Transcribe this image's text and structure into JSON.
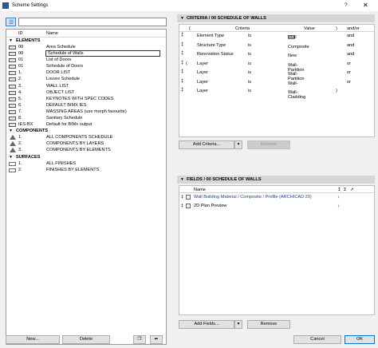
{
  "window": {
    "title": "Scheme Settings",
    "help": "?",
    "close": "✕"
  },
  "left": {
    "view_icon": "list-view-icon",
    "search": {
      "value": "",
      "placeholder": ""
    },
    "columns": {
      "id": "ID",
      "name": "Name"
    },
    "groups": [
      {
        "label": "ELEMENTS",
        "icon": "wall-icon",
        "rows": [
          {
            "id": "00",
            "name": "Area Schedule"
          },
          {
            "id": "00",
            "name": "Schedule of Walls",
            "selected": true
          },
          {
            "id": "01",
            "name": "List of Doors"
          },
          {
            "id": "01",
            "name": "Schedule of Doors"
          },
          {
            "id": "1.",
            "name": "DOOR LIST"
          },
          {
            "id": "2.",
            "name": "Louvre Schedule"
          },
          {
            "id": "3.",
            "name": "WALL LIST"
          },
          {
            "id": "4.",
            "name": "OBJECT LIST"
          },
          {
            "id": "5.",
            "name": "KEYNOTES WITH SPEC CODES"
          },
          {
            "id": "6.",
            "name": "DEFAULT BIMX IES"
          },
          {
            "id": "7.",
            "name": "MASSING AREAS (use morph favourite)"
          },
          {
            "id": "8.",
            "name": "Sanitary Schedule"
          },
          {
            "id": "IES-BX",
            "name": "Default for BIMx output"
          }
        ]
      },
      {
        "label": "COMPONENTS",
        "icon": "component-icon",
        "rows": [
          {
            "id": "1.",
            "name": "ALL COMPONENTS SCHEDULE"
          },
          {
            "id": "2.",
            "name": "COMPONENTS BY LAYERS"
          },
          {
            "id": "3.",
            "name": "COMPONENTS BY ELEMENTS"
          }
        ]
      },
      {
        "label": "SURFACES",
        "icon": "surface-icon",
        "rows": [
          {
            "id": "1.",
            "name": "ALL FINISHES"
          },
          {
            "id": "2.",
            "name": "FINISHES BY ELEMENTS"
          }
        ]
      }
    ],
    "buttons": {
      "new": "New...",
      "delete": "Delete"
    }
  },
  "criteria": {
    "header": "CRITERIA / 00 SCHEDULE OF WALLS",
    "columns": {
      "open": "(",
      "criteria": "Criteria",
      "value": "Value",
      "close": ")",
      "andor": "and/or"
    },
    "rows": [
      {
        "open": "",
        "criteria": "Element Type",
        "op": "is",
        "value": "Wall",
        "has_icon": true,
        "close": "",
        "andor": "and"
      },
      {
        "open": "",
        "criteria": "Structure Type",
        "op": "is",
        "value": "Composite",
        "has_icon": false,
        "close": "",
        "andor": "and"
      },
      {
        "open": "",
        "criteria": "Renovation Status",
        "op": "is",
        "value": "New",
        "has_icon": false,
        "close": "",
        "andor": "and"
      },
      {
        "open": "(",
        "criteria": "Layer",
        "op": "is",
        "value": "Wall- Partition",
        "has_icon": false,
        "close": "",
        "andor": "or"
      },
      {
        "open": "",
        "criteria": "Layer",
        "op": "is",
        "value": "Wall- Partition",
        "has_icon": false,
        "close": "",
        "andor": "or"
      },
      {
        "open": "",
        "criteria": "Layer",
        "op": "is",
        "value": "Wall-",
        "has_icon": false,
        "close": "",
        "andor": "or"
      },
      {
        "open": "",
        "criteria": "Layer",
        "op": "is",
        "value": "Wall- Cladding",
        "has_icon": false,
        "close": ")",
        "andor": ""
      }
    ],
    "add_button": "Add Criteria...",
    "remove_button": "Remove"
  },
  "fields": {
    "header": "FIELDS / 00 SCHEDULE OF WALLS",
    "columns": {
      "name": "Name"
    },
    "rows": [
      {
        "name": "Wall Building Material / Composite / Profile (ARCHICAD 20)",
        "link": true
      },
      {
        "name": "2D Plan Preview",
        "link": false
      }
    ],
    "add_button": "Add Fields...",
    "remove_button": "Remove"
  },
  "footer": {
    "cancel": "Cancel",
    "ok": "OK"
  }
}
